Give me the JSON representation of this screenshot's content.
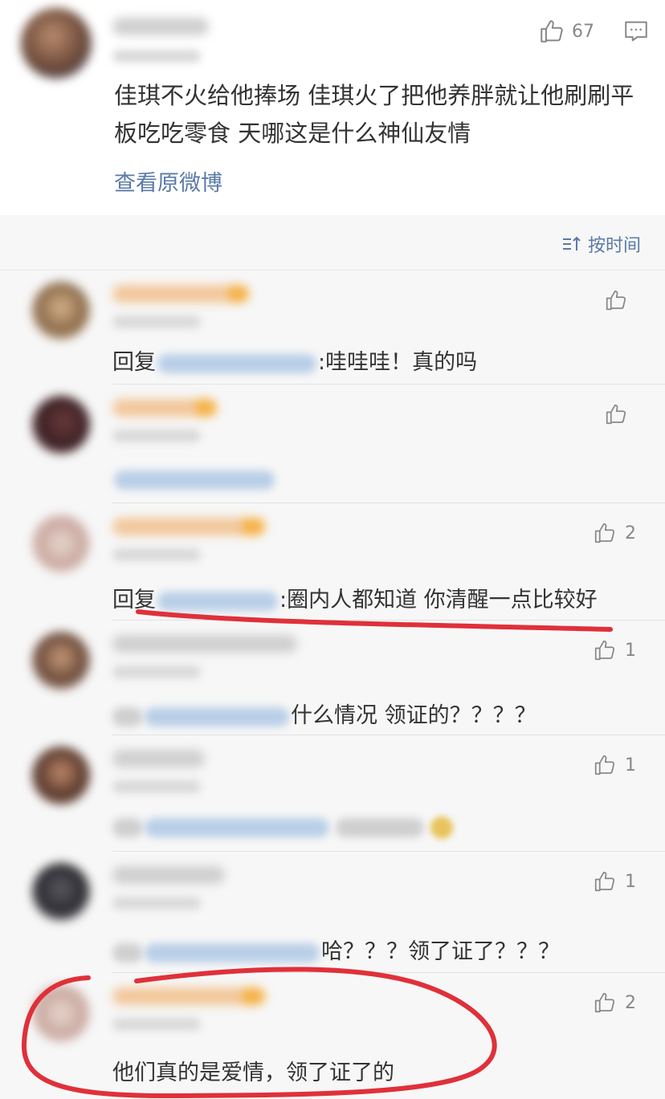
{
  "post": {
    "like_count": "67",
    "text": "佳琪不火给他捧场 佳琪火了把他养胖就让他刷刷平板吃吃零食 天哪这是什么神仙友情",
    "view_original": "查看原微博"
  },
  "sort": {
    "label": "按时间"
  },
  "comments": [
    {
      "prefix": "回复",
      "text": ":哇哇哇！真的吗",
      "likes": ""
    },
    {
      "prefix": "",
      "text": "",
      "likes": ""
    },
    {
      "prefix": "回复",
      "text": ":圈内人都知道 你清醒一点比较好",
      "likes": "2"
    },
    {
      "prefix": "",
      "text": "什么情况 领证的？？？？",
      "likes": "1"
    },
    {
      "prefix": "",
      "text": "",
      "likes": "1"
    },
    {
      "prefix": "",
      "text": "哈？？？领了证了？？？",
      "likes": "1"
    },
    {
      "prefix": "",
      "text": "他们真的是爱情，领了证了的",
      "likes": "2"
    }
  ],
  "colors": {
    "link": "#5a7aa8",
    "annotation": "#e0303a",
    "background": "#f7f7f7"
  }
}
